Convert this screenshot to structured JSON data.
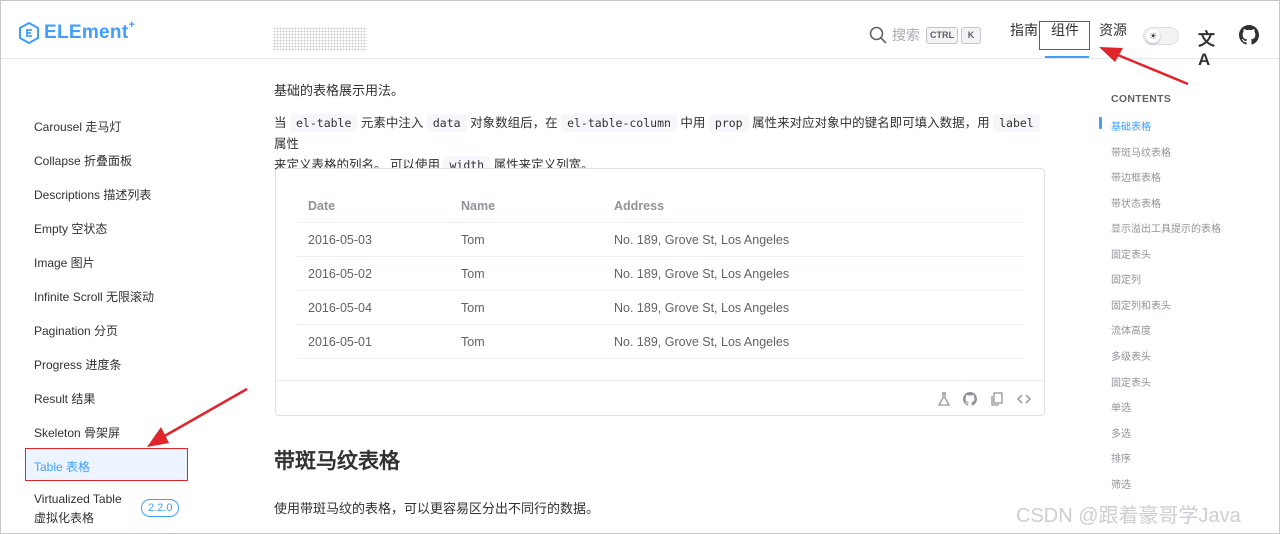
{
  "header": {
    "logo_text": "ELEment",
    "logo_sup": "+",
    "search_placeholder": "搜索",
    "kbd_ctrl": "CTRL",
    "kbd_k": "K",
    "nav_guide": "指南",
    "nav_component": "组件",
    "nav_resource": "资源",
    "lang_icon_glyph": "文A"
  },
  "sidebar": {
    "items": [
      "Carousel 走马灯",
      "Collapse 折叠面板",
      "Descriptions 描述列表",
      "Empty 空状态",
      "Image 图片",
      "Infinite Scroll 无限滚动",
      "Pagination 分页",
      "Progress 进度条",
      "Result 结果",
      "Skeleton 骨架屏",
      "Table 表格"
    ],
    "virtualized_line1": "Virtualized Table",
    "virtualized_line2": "虚拟化表格",
    "version_badge": "2.2.0"
  },
  "main": {
    "intro": "基础的表格展示用法。",
    "desc": {
      "p1": "当",
      "code1": "el-table",
      "p2": "元素中注入",
      "code2": "data",
      "p3": "对象数组后，在",
      "code3": "el-table-column",
      "p4": "中用",
      "code4": "prop",
      "p5": "属性来对应对象中的键名即可填入数据，用",
      "code5": "label",
      "p6": "属性",
      "p7": "来定义表格的列名。 可以使用",
      "code6": "width",
      "p8": "属性来定义列宽。"
    },
    "table": {
      "headers": [
        "Date",
        "Name",
        "Address"
      ],
      "rows": [
        [
          "2016-05-03",
          "Tom",
          "No. 189, Grove St, Los Angeles"
        ],
        [
          "2016-05-02",
          "Tom",
          "No. 189, Grove St, Los Angeles"
        ],
        [
          "2016-05-04",
          "Tom",
          "No. 189, Grove St, Los Angeles"
        ],
        [
          "2016-05-01",
          "Tom",
          "No. 189, Grove St, Los Angeles"
        ]
      ]
    },
    "demo_tools": [
      "flask-icon",
      "github-icon",
      "copy-icon",
      "code-icon"
    ],
    "section_title": "带斑马纹表格",
    "section_desc": "使用带斑马纹的表格，可以更容易区分出不同行的数据。"
  },
  "toc": {
    "title": "CONTENTS",
    "items": [
      "基础表格",
      "带斑马纹表格",
      "带边框表格",
      "带状态表格",
      "显示溢出工具提示的表格",
      "固定表头",
      "固定列",
      "固定列和表头",
      "流体高度",
      "多级表头",
      "固定表头",
      "单选",
      "多选",
      "排序",
      "筛选"
    ]
  },
  "watermark": "CSDN @跟着豪哥学Java",
  "colors": {
    "accent": "#409eff",
    "annotation_red": "#e0242a"
  }
}
